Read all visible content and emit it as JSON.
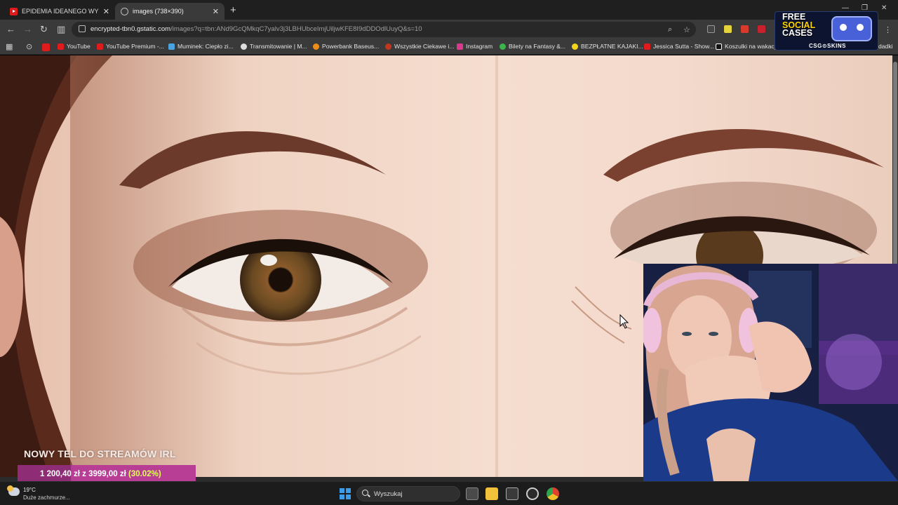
{
  "tabs": [
    {
      "title": "EPIDEMIA IDEANEGO WYGLĄD",
      "favicon": "youtube-icon"
    },
    {
      "title": "images (738×390)",
      "favicon": "globe-icon"
    }
  ],
  "address_bar": {
    "host": "encrypted-tbn0.gstatic.com",
    "path": "/images?q=tbn:ANd9GcQMkqC7yalv3j3LBHUbceImjUiljwKFE8I9dDDOdlUuyQ&s=10"
  },
  "bookmarks": [
    {
      "label": "YouTube",
      "icon_color": "#e01b1b"
    },
    {
      "label": "YouTube Premium -...",
      "icon_color": "#e01b1b"
    },
    {
      "label": "Muminek: Ciepło zi...",
      "icon_color": "#4aa3df"
    },
    {
      "label": "Transmitowanie | M...",
      "icon_color": "#dddddd"
    },
    {
      "label": "Powerbank Baseus...",
      "icon_color": "#f08c1a"
    },
    {
      "label": "Wszystkie Ciekawe i...",
      "icon_color": "#c1361f"
    },
    {
      "label": "Instagram",
      "icon_color": "#d93a8c"
    },
    {
      "label": "Bilety na Fantasy &...",
      "icon_color": "#39b54a"
    },
    {
      "label": "BEZPŁATNE KAJAKI...",
      "icon_color": "#f2d21b"
    },
    {
      "label": "Jessica Sutta - Show...",
      "icon_color": "#e01b1b"
    },
    {
      "label": "Koszulki na wakacje",
      "icon_color": "#ffffff"
    }
  ],
  "bookmarks_overflow": "dadki",
  "promo": {
    "line1": "FREE",
    "line2": "SOCIAL",
    "line3": "CASES",
    "brand": "CSG⊙SKINS"
  },
  "donation_goal": {
    "title": "NOWY TEL DO STREAMÓW IRL",
    "current": "1 200,40 zł",
    "separator": "z",
    "target": "3999,00 zł",
    "percent": "(30.02%)",
    "progress": 0.3002
  },
  "taskbar": {
    "temperature": "19°C",
    "weather": "Duże zachmurze...",
    "search_placeholder": "Wyszukaj"
  },
  "colors": {
    "accent": "#b83d95",
    "percent": "#e5ff5a",
    "windows_blue": "#3b9dea"
  }
}
